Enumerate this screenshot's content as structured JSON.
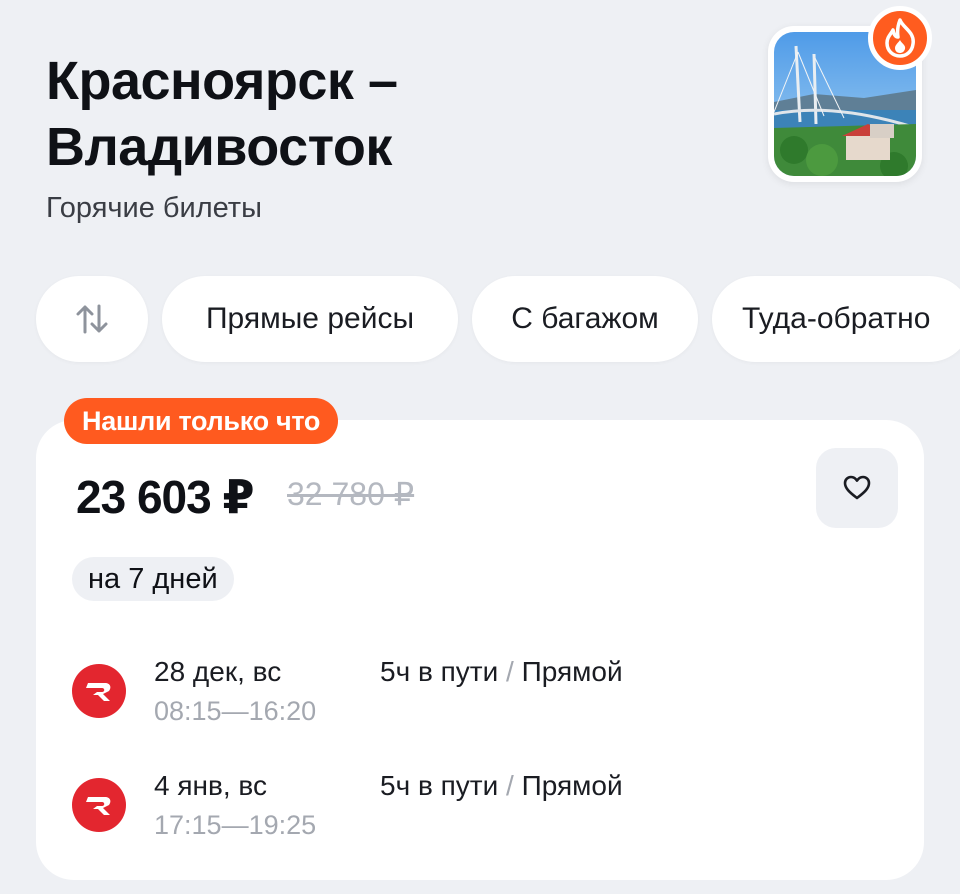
{
  "header": {
    "title_line1": "Красноярск –",
    "title_line2": "Владивосток",
    "subtitle": "Горячие билеты"
  },
  "filters": {
    "sort_icon": "sort-arrows-icon",
    "chips": [
      "Прямые рейсы",
      "С багажом",
      "Туда-обратно"
    ]
  },
  "offer": {
    "badge": "Нашли только что",
    "price": "23 603 ₽",
    "old_price": "32 780 ₽",
    "duration": "на 7 дней",
    "favorite_icon": "heart-icon",
    "legs": [
      {
        "date": "28 дек, вс",
        "depart": "08:15",
        "arrive": "16:20",
        "travel": "5ч в пути",
        "separator": "/",
        "type": "Прямой",
        "airline_icon": "airline-logo-icon"
      },
      {
        "date": "4 янв, вс",
        "depart": "17:15",
        "arrive": "19:25",
        "travel": "5ч в пути",
        "separator": "/",
        "type": "Прямой",
        "airline_icon": "airline-logo-icon"
      }
    ],
    "time_dash": "—"
  },
  "colors": {
    "background": "#eef0f4",
    "accent": "#ff5a1f",
    "airline_red": "#e3262f"
  }
}
